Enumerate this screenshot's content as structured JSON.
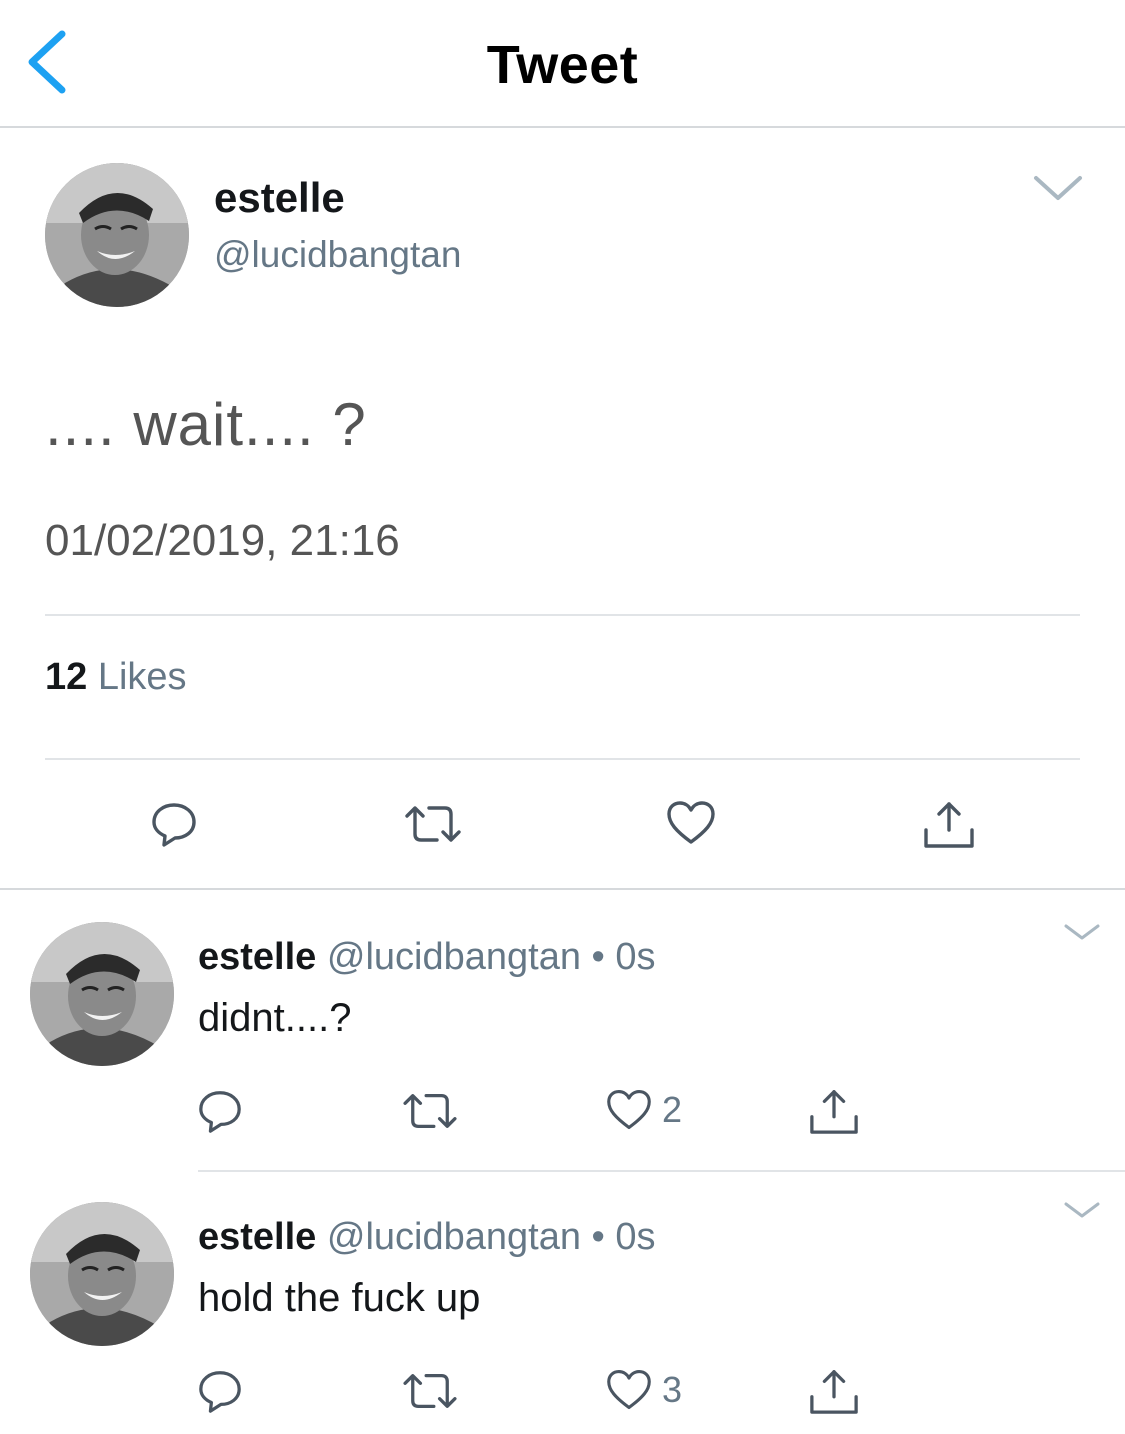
{
  "header": {
    "title": "Tweet",
    "back_icon": "chevron-left-icon"
  },
  "colors": {
    "accent": "#1da1f2",
    "secondary_text": "#657786",
    "divider": "#e1e4e7"
  },
  "main_tweet": {
    "display_name": "estelle",
    "handle": "@lucidbangtan",
    "text": ".... wait.... ?",
    "timestamp": "01/02/2019, 21:16",
    "likes_count": "12",
    "likes_label": "Likes"
  },
  "replies": [
    {
      "display_name": "estelle",
      "handle": "@lucidbangtan",
      "separator": "•",
      "time": "0s",
      "text": "didnt....?",
      "like_count": "2"
    },
    {
      "display_name": "estelle",
      "handle": "@lucidbangtan",
      "separator": "•",
      "time": "0s",
      "text": "hold the fuck up",
      "like_count": "3"
    }
  ]
}
